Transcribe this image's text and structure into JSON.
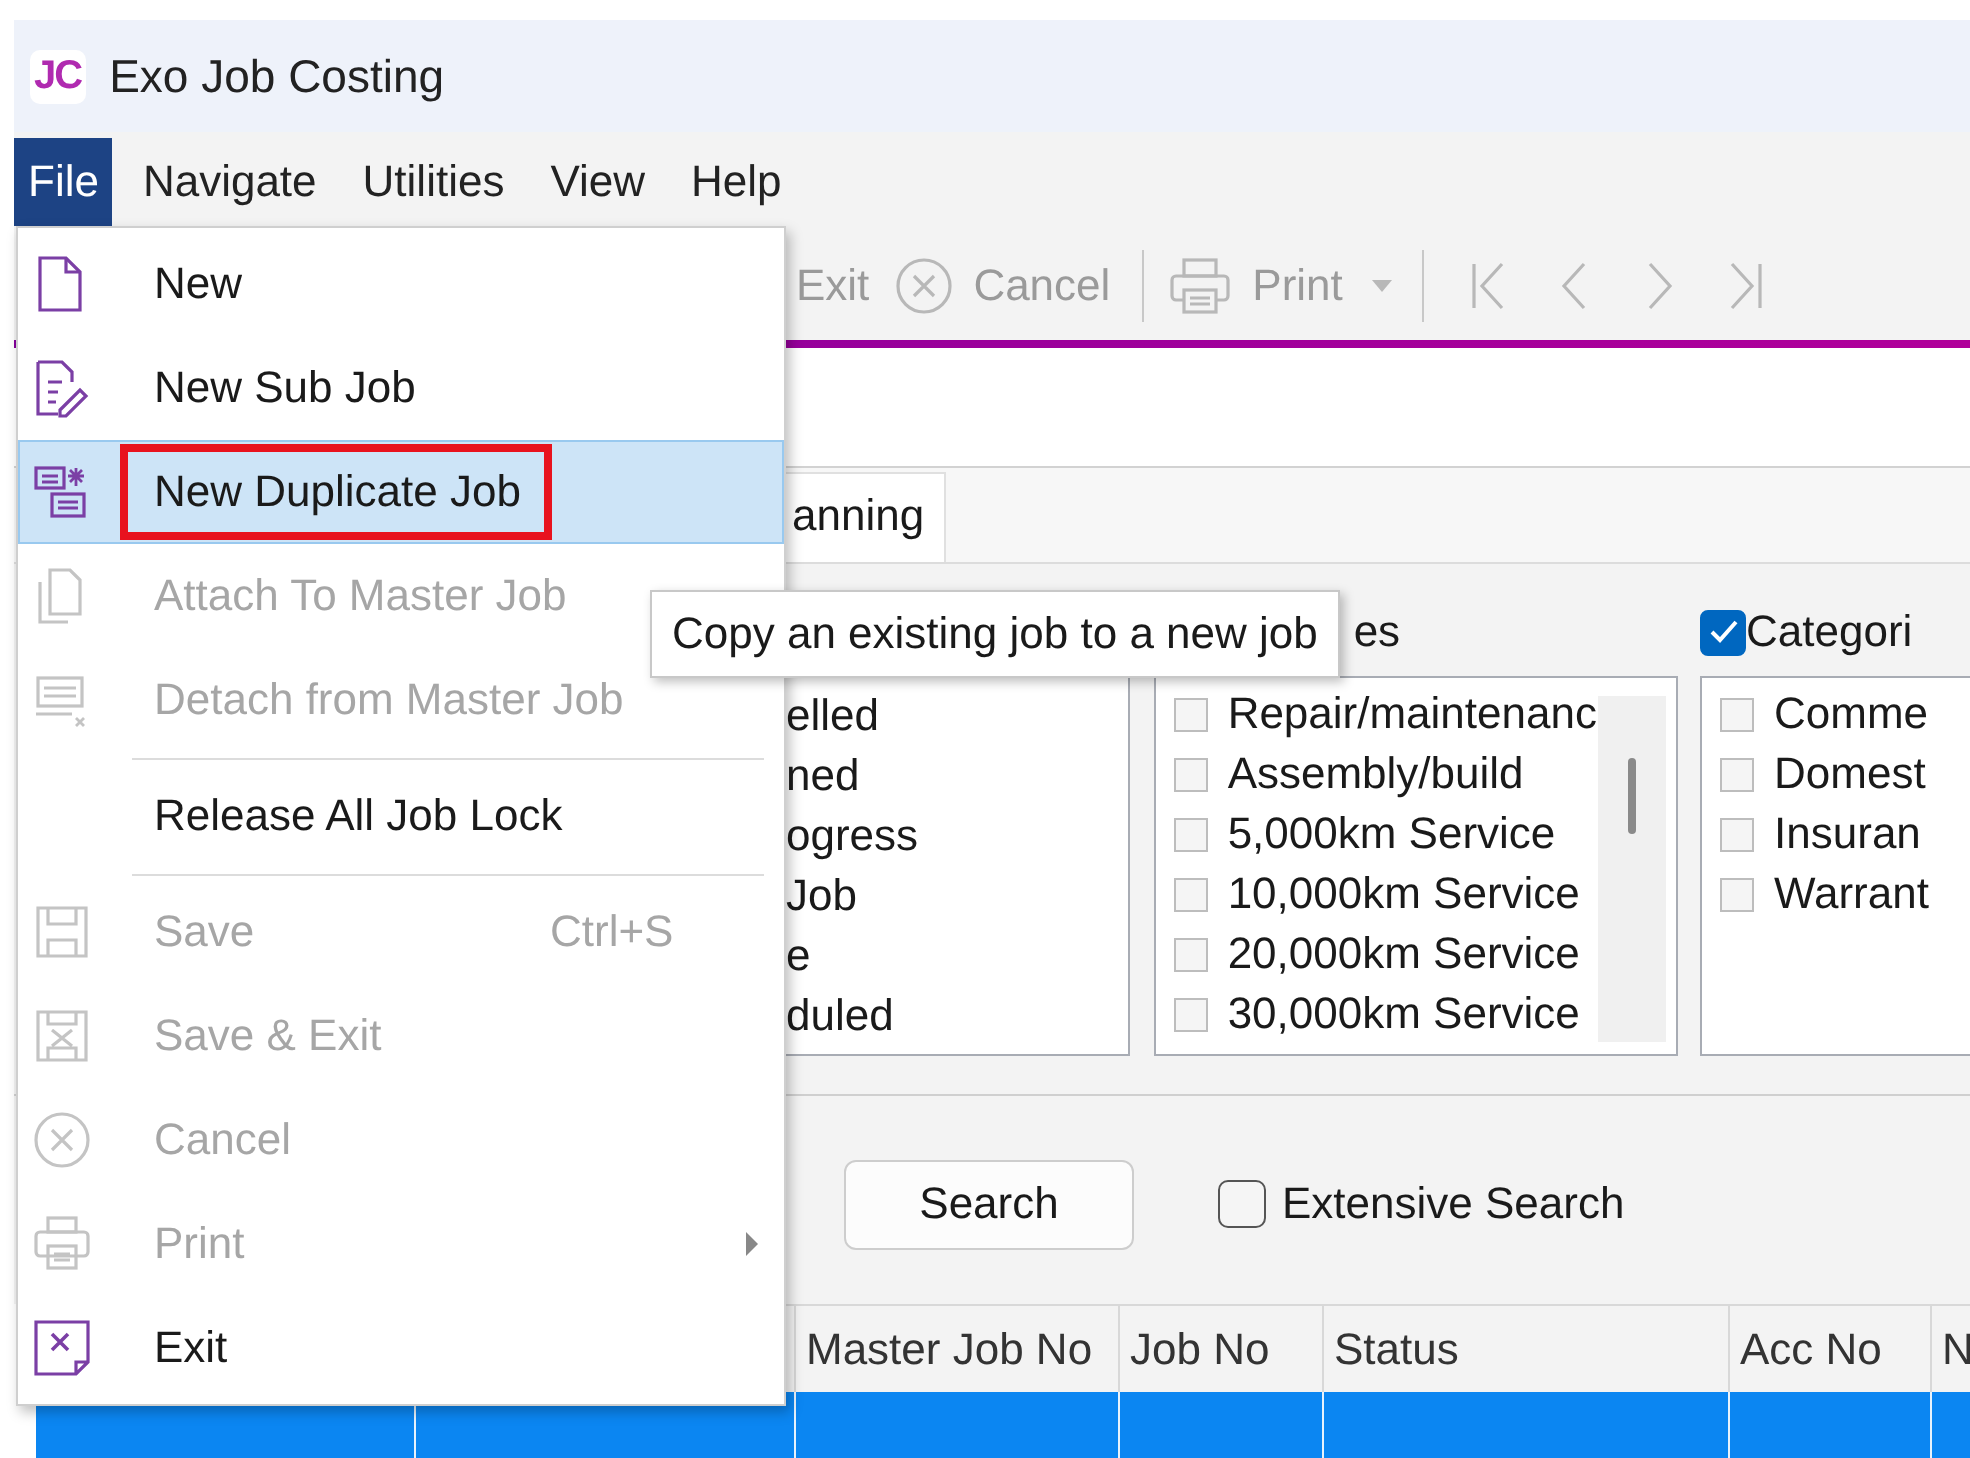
{
  "window": {
    "logo": "JC",
    "title": "Exo Job Costing"
  },
  "menu_bar": [
    {
      "label": "File",
      "selected": true
    },
    {
      "label": "Navigate",
      "selected": false
    },
    {
      "label": "Utilities",
      "selected": false
    },
    {
      "label": "View",
      "selected": false
    },
    {
      "label": "Help",
      "selected": false
    }
  ],
  "toolbar": {
    "buttons": [
      {
        "label": "Exit",
        "disabled": true,
        "dropdown": false
      },
      {
        "label": "Cancel",
        "disabled": true,
        "dropdown": false
      },
      {
        "label": "Print",
        "disabled": true,
        "dropdown": true
      }
    ],
    "nav_buttons": [
      {
        "disabled": true
      },
      {
        "disabled": true
      },
      {
        "disabled": true
      },
      {
        "disabled": true
      }
    ]
  },
  "tabs": [
    {
      "label": "anning",
      "selected": true
    }
  ],
  "filters": {
    "status_list": {
      "items": [
        "elled",
        "ned",
        "ogress",
        "Job",
        "e",
        "duled"
      ]
    },
    "job_types": {
      "header": "es",
      "items": [
        {
          "label": "Repair/maintenanc",
          "checked": false
        },
        {
          "label": "Assembly/build",
          "checked": false
        },
        {
          "label": "5,000km Service",
          "checked": false
        },
        {
          "label": "10,000km Service",
          "checked": false
        },
        {
          "label": "20,000km Service",
          "checked": false
        },
        {
          "label": "30,000km Service",
          "checked": false
        }
      ]
    },
    "categories": {
      "header": "Categori",
      "checked": true,
      "items": [
        {
          "label": "Comme",
          "checked": false
        },
        {
          "label": "Domest",
          "checked": false
        },
        {
          "label": "Insuran",
          "checked": false
        },
        {
          "label": "Warrant",
          "checked": false
        }
      ]
    }
  },
  "search": {
    "button": "Search",
    "extensive_search": {
      "label": "Extensive Search",
      "checked": false
    }
  },
  "table": {
    "columns": [
      "Master Job No",
      "Job No",
      "Status",
      "Acc No",
      "N"
    ],
    "rows": [
      {
        "selected": true
      }
    ]
  },
  "file_menu": {
    "items": [
      {
        "kind": "item",
        "label": "New",
        "disabled": false,
        "selected": false
      },
      {
        "kind": "item",
        "label": "New Sub Job",
        "disabled": false,
        "selected": false
      },
      {
        "kind": "item",
        "label": "New Duplicate Job",
        "disabled": false,
        "selected": true,
        "annotated": true
      },
      {
        "kind": "item",
        "label": "Attach To Master Job",
        "disabled": true,
        "selected": false
      },
      {
        "kind": "item",
        "label": "Detach from Master Job",
        "disabled": true,
        "selected": false
      },
      {
        "kind": "separator"
      },
      {
        "kind": "item",
        "label": "Release All Job Lock",
        "disabled": false,
        "selected": false
      },
      {
        "kind": "separator"
      },
      {
        "kind": "item",
        "label": "Save",
        "disabled": true,
        "selected": false,
        "shortcut": "Ctrl+S"
      },
      {
        "kind": "item",
        "label": "Save & Exit",
        "disabled": true,
        "selected": false
      },
      {
        "kind": "item",
        "label": "Cancel",
        "disabled": true,
        "selected": false
      },
      {
        "kind": "item",
        "label": "Print",
        "disabled": true,
        "selected": false,
        "submenu": true
      },
      {
        "kind": "item",
        "label": "Exit",
        "disabled": false,
        "selected": false
      }
    ]
  },
  "tooltip": {
    "text": "Copy an existing job to a new job"
  }
}
